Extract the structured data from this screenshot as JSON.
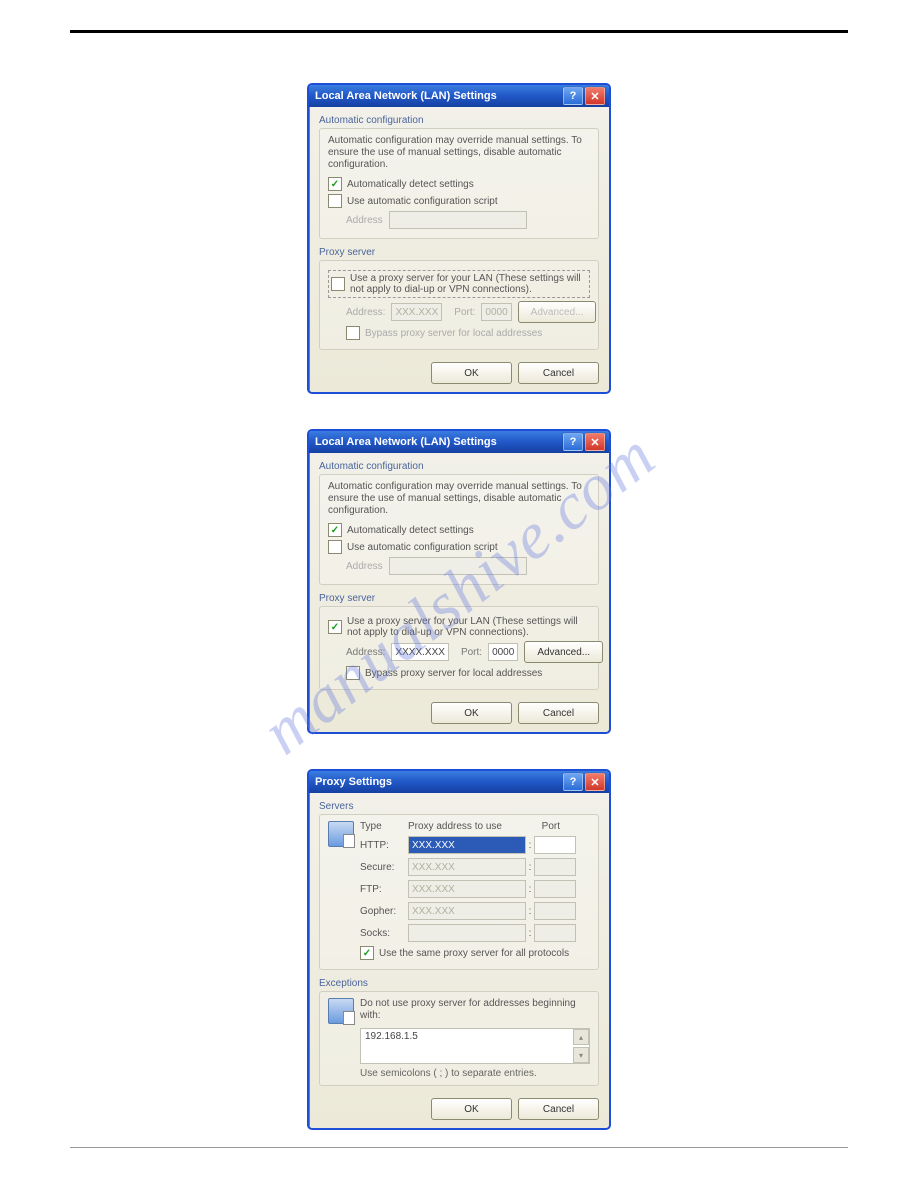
{
  "watermark": "manualshive.com",
  "dlg1": {
    "title": "Local Area Network (LAN) Settings",
    "auto": {
      "legend": "Automatic configuration",
      "desc": "Automatic configuration may override manual settings.  To ensure the use of manual settings, disable automatic configuration.",
      "detect": "Automatically detect settings",
      "script": "Use automatic configuration script",
      "addr_label": "Address"
    },
    "proxy": {
      "legend": "Proxy server",
      "use": "Use a proxy server for your LAN (These settings will not apply to dial-up or VPN connections).",
      "addr_label": "Address:",
      "addr_val": "XXX.XXX",
      "port_label": "Port:",
      "port_val": "0000",
      "advanced": "Advanced...",
      "bypass": "Bypass proxy server for local addresses"
    },
    "ok": "OK",
    "cancel": "Cancel"
  },
  "dlg2": {
    "title": "Local Area Network (LAN) Settings",
    "auto": {
      "legend": "Automatic configuration",
      "desc": "Automatic configuration may override manual settings.  To ensure the use of manual settings, disable automatic configuration.",
      "detect": "Automatically detect settings",
      "script": "Use automatic configuration script",
      "addr_label": "Address"
    },
    "proxy": {
      "legend": "Proxy server",
      "use": "Use a proxy server for your LAN (These settings will not apply to dial-up or VPN connections).",
      "addr_label": "Address:",
      "addr_val": "XXXX.XXX",
      "port_label": "Port:",
      "port_val": "0000",
      "advanced": "Advanced...",
      "bypass": "Bypass proxy server for local addresses"
    },
    "ok": "OK",
    "cancel": "Cancel"
  },
  "dlg3": {
    "title": "Proxy Settings",
    "servers": {
      "legend": "Servers",
      "type": "Type",
      "addr_head": "Proxy address to use",
      "port_head": "Port",
      "http": "HTTP:",
      "http_val": "XXX.XXX",
      "secure": "Secure:",
      "secure_val": "XXX.XXX",
      "ftp": "FTP:",
      "ftp_val": "XXX.XXX",
      "gopher": "Gopher:",
      "gopher_val": "XXX.XXX",
      "socks": "Socks:",
      "socks_val": "",
      "same": "Use the same proxy server for all protocols"
    },
    "exc": {
      "legend": "Exceptions",
      "desc": "Do not use proxy server for addresses beginning with:",
      "value": "192.168.1.5",
      "hint": "Use semicolons ( ; ) to separate entries."
    },
    "ok": "OK",
    "cancel": "Cancel"
  }
}
